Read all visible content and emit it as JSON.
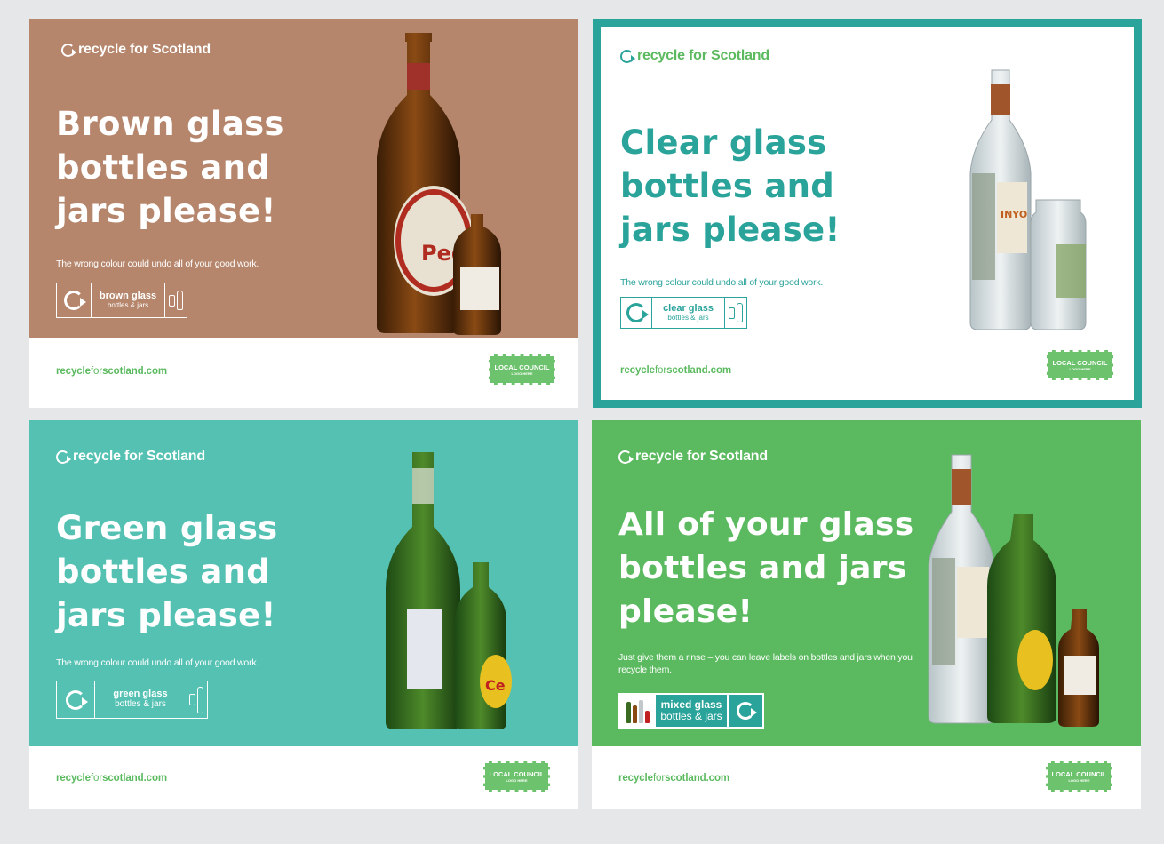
{
  "brand": "recycle for Scotland",
  "url": {
    "part1": "recycle",
    "part2": "for",
    "part3": "scotland.com"
  },
  "council": {
    "line1": "LOCAL COUNCIL",
    "line2": "LOGO HERE"
  },
  "posters": [
    {
      "headline": [
        "Brown glass",
        "bottles and",
        "jars please!"
      ],
      "tagline": "The wrong colour could undo all of your good work.",
      "bin_main": "brown glass",
      "bin_sub": "bottles & jars",
      "panel_color": "#b6866c",
      "label_text": "Ped"
    },
    {
      "headline": [
        "Clear glass",
        "bottles and",
        "jars please!"
      ],
      "tagline": "The wrong colour could undo all of your good work.",
      "bin_main": "clear glass",
      "bin_sub": "bottles & jars",
      "panel_color": "#ffffff",
      "accent_color": "#2aa39a",
      "label_text": "INYO"
    },
    {
      "headline": [
        "Green glass",
        "bottles and",
        "jars please!"
      ],
      "tagline": "The wrong colour could undo all of your good work.",
      "bin_main": "green glass",
      "bin_sub": "bottles & jars",
      "panel_color": "#55c1b3",
      "label_text": "Ce"
    },
    {
      "headline": [
        "All of your glass",
        "bottles and jars",
        "please!"
      ],
      "tagline": "Just give them a rinse – you can leave labels on bottles and jars when you recycle them.",
      "bin_main": "mixed glass",
      "bin_sub": "bottles & jars",
      "panel_color": "#5bba5f"
    }
  ],
  "icons": [
    "recycle-arrow-icon",
    "jar-icon",
    "bottle-icon"
  ]
}
